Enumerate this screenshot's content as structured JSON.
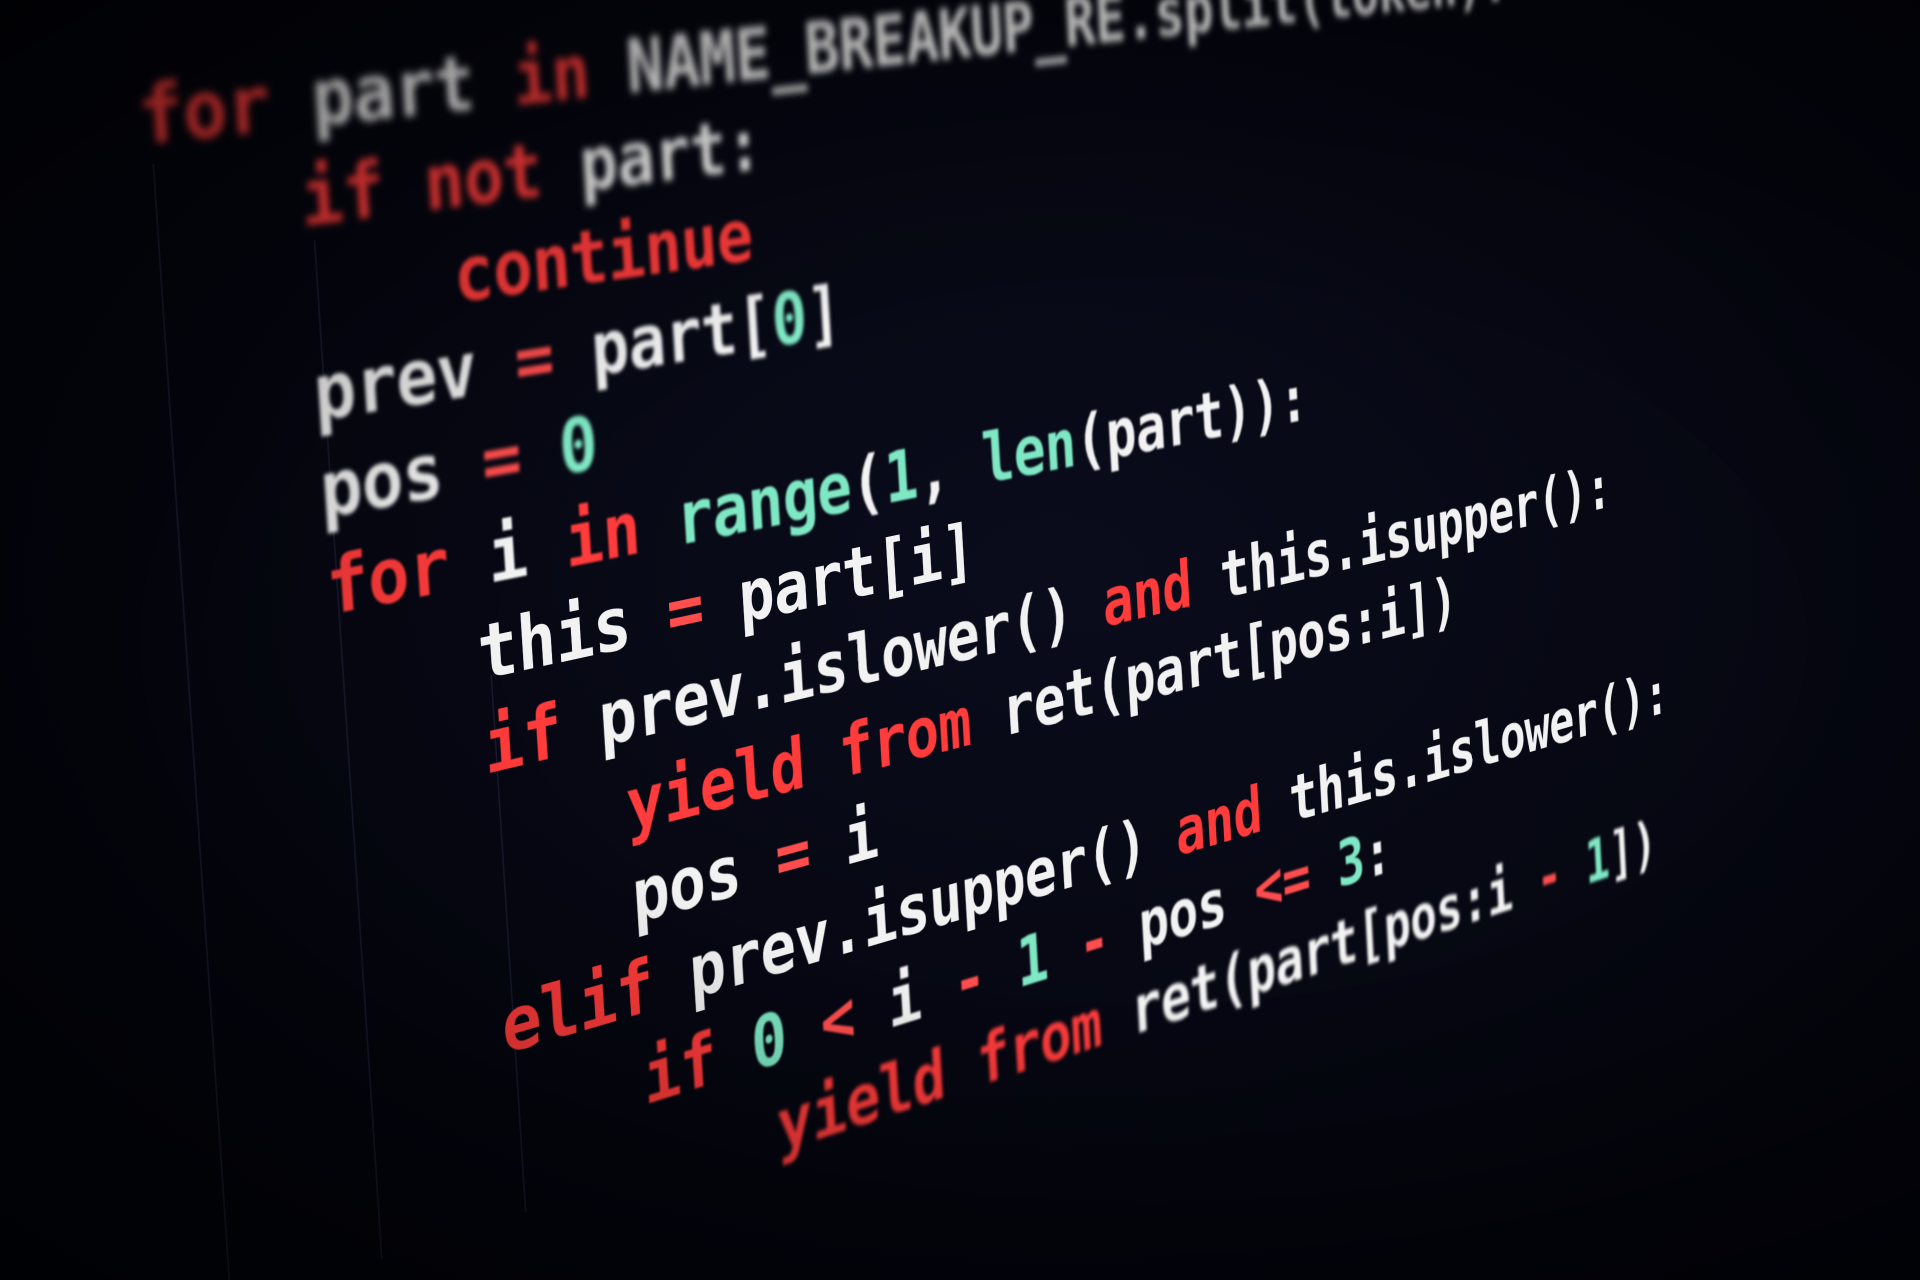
{
  "code_lines": [
    {
      "tokens": [
        {
          "t": "for",
          "k": "kw"
        },
        {
          "t": " ",
          "k": "id"
        },
        {
          "t": "part",
          "k": "id"
        },
        {
          "t": " ",
          "k": "id"
        },
        {
          "t": "in",
          "k": "kw"
        },
        {
          "t": " ",
          "k": "id"
        },
        {
          "t": "NAME_BREAKUP_RE",
          "k": "id"
        },
        {
          "t": ".",
          "k": "punct"
        },
        {
          "t": "split",
          "k": "id"
        },
        {
          "t": "(",
          "k": "punct"
        },
        {
          "t": "token",
          "k": "id"
        },
        {
          "t": "):",
          "k": "punct"
        }
      ]
    },
    {
      "tokens": [
        {
          "t": "if",
          "k": "kw"
        },
        {
          "t": " ",
          "k": "id"
        },
        {
          "t": "not",
          "k": "kw"
        },
        {
          "t": " ",
          "k": "id"
        },
        {
          "t": "part",
          "k": "id"
        },
        {
          "t": ":",
          "k": "punct"
        }
      ]
    },
    {
      "tokens": [
        {
          "t": "continue",
          "k": "kw"
        }
      ]
    },
    {
      "tokens": [
        {
          "t": "prev",
          "k": "id"
        },
        {
          "t": " ",
          "k": "id"
        },
        {
          "t": "=",
          "k": "op"
        },
        {
          "t": " ",
          "k": "id"
        },
        {
          "t": "part",
          "k": "id"
        },
        {
          "t": "[",
          "k": "punct"
        },
        {
          "t": "0",
          "k": "num"
        },
        {
          "t": "]",
          "k": "punct"
        }
      ]
    },
    {
      "tokens": [
        {
          "t": "pos",
          "k": "id"
        },
        {
          "t": " ",
          "k": "id"
        },
        {
          "t": "=",
          "k": "op"
        },
        {
          "t": " ",
          "k": "id"
        },
        {
          "t": "0",
          "k": "num"
        }
      ]
    },
    {
      "tokens": [
        {
          "t": "for",
          "k": "kw"
        },
        {
          "t": " ",
          "k": "id"
        },
        {
          "t": "i",
          "k": "id"
        },
        {
          "t": " ",
          "k": "id"
        },
        {
          "t": "in",
          "k": "kw"
        },
        {
          "t": " ",
          "k": "id"
        },
        {
          "t": "range",
          "k": "bi"
        },
        {
          "t": "(",
          "k": "punct"
        },
        {
          "t": "1",
          "k": "num"
        },
        {
          "t": ", ",
          "k": "punct"
        },
        {
          "t": "len",
          "k": "bi"
        },
        {
          "t": "(",
          "k": "punct"
        },
        {
          "t": "part",
          "k": "id"
        },
        {
          "t": ")):",
          "k": "punct"
        }
      ]
    },
    {
      "tokens": [
        {
          "t": "this",
          "k": "id"
        },
        {
          "t": " ",
          "k": "id"
        },
        {
          "t": "=",
          "k": "op"
        },
        {
          "t": " ",
          "k": "id"
        },
        {
          "t": "part",
          "k": "id"
        },
        {
          "t": "[",
          "k": "punct"
        },
        {
          "t": "i",
          "k": "id"
        },
        {
          "t": "]",
          "k": "punct"
        }
      ]
    },
    {
      "tokens": [
        {
          "t": "if",
          "k": "kw"
        },
        {
          "t": " ",
          "k": "id"
        },
        {
          "t": "prev",
          "k": "id"
        },
        {
          "t": ".",
          "k": "punct"
        },
        {
          "t": "islower",
          "k": "id"
        },
        {
          "t": "()",
          "k": "punct"
        },
        {
          "t": " ",
          "k": "id"
        },
        {
          "t": "and",
          "k": "kw"
        },
        {
          "t": " ",
          "k": "id"
        },
        {
          "t": "this",
          "k": "id"
        },
        {
          "t": ".",
          "k": "punct"
        },
        {
          "t": "isupper",
          "k": "id"
        },
        {
          "t": "():",
          "k": "punct"
        }
      ]
    },
    {
      "tokens": [
        {
          "t": "yield",
          "k": "kw"
        },
        {
          "t": " ",
          "k": "id"
        },
        {
          "t": "from",
          "k": "kw"
        },
        {
          "t": " ",
          "k": "id"
        },
        {
          "t": "ret",
          "k": "id"
        },
        {
          "t": "(",
          "k": "punct"
        },
        {
          "t": "part",
          "k": "id"
        },
        {
          "t": "[",
          "k": "punct"
        },
        {
          "t": "pos",
          "k": "id"
        },
        {
          "t": ":",
          "k": "punct"
        },
        {
          "t": "i",
          "k": "id"
        },
        {
          "t": "])",
          "k": "punct"
        }
      ]
    },
    {
      "tokens": [
        {
          "t": "pos",
          "k": "id"
        },
        {
          "t": " ",
          "k": "id"
        },
        {
          "t": "=",
          "k": "op"
        },
        {
          "t": " ",
          "k": "id"
        },
        {
          "t": "i",
          "k": "id"
        }
      ]
    },
    {
      "tokens": [
        {
          "t": "elif",
          "k": "kw"
        },
        {
          "t": " ",
          "k": "id"
        },
        {
          "t": "prev",
          "k": "id"
        },
        {
          "t": ".",
          "k": "punct"
        },
        {
          "t": "isupper",
          "k": "id"
        },
        {
          "t": "()",
          "k": "punct"
        },
        {
          "t": " ",
          "k": "id"
        },
        {
          "t": "and",
          "k": "kw"
        },
        {
          "t": " ",
          "k": "id"
        },
        {
          "t": "this",
          "k": "id"
        },
        {
          "t": ".",
          "k": "punct"
        },
        {
          "t": "islower",
          "k": "id"
        },
        {
          "t": "():",
          "k": "punct"
        }
      ]
    },
    {
      "tokens": [
        {
          "t": "if",
          "k": "kw"
        },
        {
          "t": " ",
          "k": "id"
        },
        {
          "t": "0",
          "k": "num"
        },
        {
          "t": " ",
          "k": "id"
        },
        {
          "t": "<",
          "k": "op"
        },
        {
          "t": " ",
          "k": "id"
        },
        {
          "t": "i",
          "k": "id"
        },
        {
          "t": " ",
          "k": "id"
        },
        {
          "t": "-",
          "k": "op"
        },
        {
          "t": " ",
          "k": "id"
        },
        {
          "t": "1",
          "k": "num"
        },
        {
          "t": " ",
          "k": "id"
        },
        {
          "t": "-",
          "k": "op"
        },
        {
          "t": " ",
          "k": "id"
        },
        {
          "t": "pos",
          "k": "id"
        },
        {
          "t": " ",
          "k": "id"
        },
        {
          "t": "<=",
          "k": "op"
        },
        {
          "t": " ",
          "k": "id"
        },
        {
          "t": "3",
          "k": "num"
        },
        {
          "t": ":",
          "k": "punct"
        }
      ]
    },
    {
      "tokens": [
        {
          "t": "yield",
          "k": "kw"
        },
        {
          "t": " ",
          "k": "id"
        },
        {
          "t": "from",
          "k": "kw"
        },
        {
          "t": " ",
          "k": "id"
        },
        {
          "t": "ret",
          "k": "id"
        },
        {
          "t": "(",
          "k": "punct"
        },
        {
          "t": "part",
          "k": "id"
        },
        {
          "t": "[",
          "k": "punct"
        },
        {
          "t": "pos",
          "k": "id"
        },
        {
          "t": ":",
          "k": "punct"
        },
        {
          "t": "i",
          "k": "id"
        },
        {
          "t": " ",
          "k": "id"
        },
        {
          "t": "-",
          "k": "op"
        },
        {
          "t": " ",
          "k": "id"
        },
        {
          "t": "1",
          "k": "num"
        },
        {
          "t": "])",
          "k": "punct"
        }
      ]
    }
  ],
  "colors": {
    "background": "#05060f",
    "keyword": "#ff3b3b",
    "identifier": "#f2f2f2",
    "operator": "#ff4d4d",
    "number": "#7ee7c3",
    "builtin": "#7ee7c3"
  }
}
